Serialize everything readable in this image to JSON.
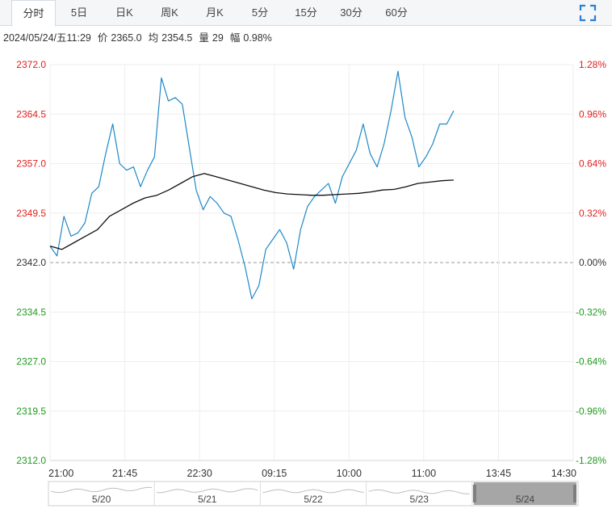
{
  "tabs": [
    {
      "label": "分时",
      "active": true
    },
    {
      "label": "5日",
      "active": false
    },
    {
      "label": "日K",
      "active": false
    },
    {
      "label": "周K",
      "active": false
    },
    {
      "label": "月K",
      "active": false
    },
    {
      "label": "5分",
      "active": false
    },
    {
      "label": "15分",
      "active": false
    },
    {
      "label": "30分",
      "active": false
    },
    {
      "label": "60分",
      "active": false
    }
  ],
  "fullscreen_icon": "fullscreen-icon",
  "info": {
    "datetime": "2024/05/24/五11:29",
    "price_label": "价",
    "price": "2365.0",
    "avg_label": "均",
    "avg": "2354.5",
    "volume_label": "量",
    "volume": "29",
    "change_label": "幅",
    "change": "0.98%"
  },
  "colors": {
    "price_line": "#1e88c8",
    "avg_line": "#111111",
    "up": "#e02020",
    "down": "#1f9a1f",
    "neutral": "#333333",
    "grid": "#eeeeee",
    "baseline": "#999999"
  },
  "chart_data": {
    "type": "line",
    "y_ticks": [
      "2372.0",
      "2364.5",
      "2357.0",
      "2349.5",
      "2342.0",
      "2334.5",
      "2327.0",
      "2319.5",
      "2312.0"
    ],
    "pct_ticks": [
      "1.28%",
      "0.96%",
      "0.64%",
      "0.32%",
      "0.00%",
      "-0.32%",
      "-0.64%",
      "-0.96%",
      "-1.28%"
    ],
    "ylim": [
      2312.0,
      2372.0
    ],
    "prev_close": 2342.0,
    "x_ticks": [
      "21:00",
      "21:45",
      "22:30",
      "09:15",
      "10:00",
      "11:00",
      "13:45",
      "14:30"
    ],
    "session_points": 44,
    "series": [
      {
        "key": "price",
        "values": [
          2344.5,
          2343.0,
          2349.0,
          2346.0,
          2346.5,
          2348.0,
          2352.5,
          2353.5,
          2358.5,
          2363.0,
          2357.0,
          2356.0,
          2356.5,
          2353.5,
          2356.0,
          2358.0,
          2370.0,
          2366.5,
          2367.0,
          2366.0,
          2359.5,
          2353.0,
          2350.0,
          2352.0,
          2351.0,
          2349.5,
          2349.0,
          2345.5,
          2341.5,
          2336.5,
          2338.5,
          2344.0,
          2345.5,
          2347.0,
          2345.0,
          2341.0,
          2347.0,
          2350.5,
          2352.0,
          2353.0,
          2354.0,
          2351.0,
          2355.0,
          2357.0,
          2359.0,
          2363.0,
          2358.5,
          2356.5,
          2360.0,
          2365.0,
          2371.0,
          2364.0,
          2361.0,
          2356.5,
          2358.0,
          2360.0,
          2363.0,
          2363.0,
          2365.0
        ]
      },
      {
        "key": "avg",
        "values": [
          2344.5,
          2344.0,
          2345.0,
          2346.0,
          2347.0,
          2349.0,
          2350.0,
          2351.0,
          2351.8,
          2352.2,
          2353.0,
          2354.0,
          2355.0,
          2355.5,
          2355.0,
          2354.5,
          2354.0,
          2353.5,
          2353.0,
          2352.6,
          2352.4,
          2352.3,
          2352.2,
          2352.2,
          2352.3,
          2352.4,
          2352.5,
          2352.7,
          2353.0,
          2353.1,
          2353.5,
          2354.0,
          2354.2,
          2354.4,
          2354.5
        ]
      }
    ],
    "navigator": {
      "labels": [
        "5/20",
        "5/21",
        "5/22",
        "5/23",
        "5/24"
      ]
    }
  }
}
